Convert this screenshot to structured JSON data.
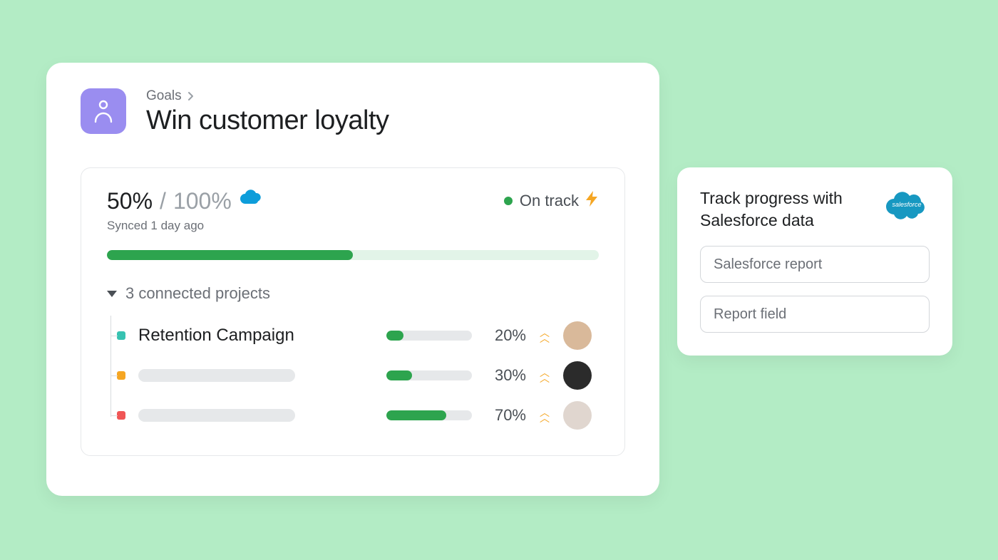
{
  "breadcrumb": {
    "goals": "Goals"
  },
  "page": {
    "title": "Win customer loyalty"
  },
  "progress": {
    "current": "50%",
    "target": "100%",
    "synced": "Synced 1 day ago",
    "status_label": "On track",
    "percent": 50
  },
  "connected": {
    "label": "3 connected projects"
  },
  "projects": [
    {
      "name": "Retention Campaign",
      "percent": 20,
      "dot": "#37c2b1",
      "has_name": true,
      "avatar_bg": "#d9b99a"
    },
    {
      "name": "",
      "percent": 30,
      "dot": "#f5a623",
      "has_name": false,
      "avatar_bg": "#2b2b2b"
    },
    {
      "name": "",
      "percent": 70,
      "dot": "#f05656",
      "has_name": false,
      "avatar_bg": "#e0d6cf"
    }
  ],
  "side": {
    "title": "Track progress with Salesforce data",
    "input1_placeholder": "Salesforce report",
    "input2_placeholder": "Report field"
  },
  "colors": {
    "salesforce_blue": "#0d9dda",
    "green": "#2da44e"
  }
}
